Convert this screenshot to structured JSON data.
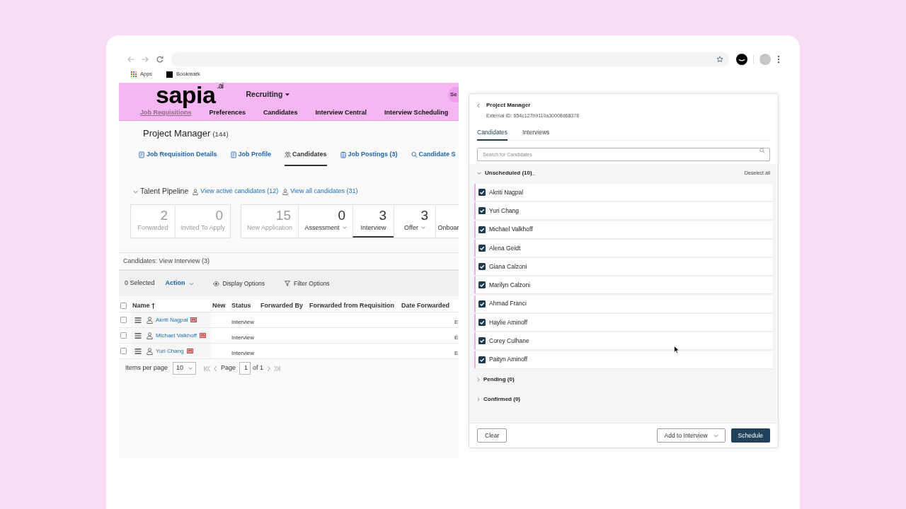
{
  "browser": {
    "bookmarks": [
      {
        "kind": "apps",
        "label": "Apps"
      },
      {
        "kind": "site",
        "label": "Bookmark"
      }
    ]
  },
  "header": {
    "logo": "sapia$^{.ai}$",
    "product_menu": "Recruiting",
    "search": "Se",
    "nav": [
      {
        "label": "Job Requisitions",
        "selected": true
      },
      {
        "label": "Preferences",
        "selected": false
      },
      {
        "label": "Candidates",
        "selected": false
      },
      {
        "label": "Interview Central",
        "selected": false
      },
      {
        "label": "Interview Scheduling",
        "selected": false
      }
    ]
  },
  "requisition": {
    "title": "Project Manager",
    "count": "(144)",
    "tabs": [
      {
        "label": "Job Requisition Details",
        "selected": false
      },
      {
        "label": "Job Profile",
        "selected": false
      },
      {
        "label": "Candidates",
        "selected": true
      },
      {
        "label": "Job Postings (3)",
        "selected": false
      },
      {
        "label": "Candidate S",
        "selected": false
      }
    ]
  },
  "pipeline": {
    "title": "Talent Pipeline",
    "expanded": true,
    "links": [
      "View active candidates (12)",
      "View all candidates (31)"
    ],
    "groups": [
      [
        {
          "count": "2",
          "label": "Forwarded",
          "muted": true,
          "has_menu": false,
          "selected": false
        },
        {
          "count": "0",
          "label": "Invited To Apply",
          "muted": true,
          "has_menu": false,
          "selected": false
        }
      ],
      [
        {
          "count": "15",
          "label": "New Application",
          "muted": true,
          "has_menu": false,
          "selected": false
        },
        {
          "count": "0",
          "label": "Assessment",
          "muted": false,
          "has_menu": true,
          "selected": false
        },
        {
          "count": "3",
          "label": "Interview",
          "muted": false,
          "has_menu": false,
          "selected": true
        },
        {
          "count": "3",
          "label": "Offer",
          "muted": false,
          "has_menu": true,
          "selected": false
        },
        {
          "label": "Onboar",
          "muted": false,
          "has_menu": false,
          "selected": false
        }
      ]
    ]
  },
  "candidates": {
    "title": "Candidates: View Interview (3)",
    "selected_count": "0 Selected",
    "action": "Action",
    "display_options": "Display Options",
    "filter_options": "Filter Options",
    "all_checked": false,
    "columns": [
      {
        "label": "Name",
        "sorted": true
      },
      {
        "label": "New",
        "sorted": false
      },
      {
        "label": "Status",
        "sorted": false
      },
      {
        "label": "Forwarded By",
        "sorted": false
      },
      {
        "label": "Forwarded from Requisition",
        "sorted": false
      },
      {
        "label": "Date Forwarded",
        "sorted": false
      }
    ],
    "rows": [
      {
        "checked": false,
        "name": "Akriti Nagpal",
        "status": "Interview",
        "column_7": "E"
      },
      {
        "checked": false,
        "name": "Michael Valkhoff",
        "status": "Interview",
        "column_7": "E"
      },
      {
        "checked": false,
        "name": "Yuri Chang",
        "status": "Interview",
        "column_7": "E"
      }
    ],
    "pagination": {
      "items_per_page": "Items per page",
      "per_page": "10",
      "page_label": "Page",
      "page": "1",
      "page_count": "of 1"
    }
  },
  "panel": {
    "title": "Project Manager",
    "external_id": "External ID: 654c127b9110a30008d68378",
    "tabs": [
      {
        "label": "Candidates",
        "selected": true
      },
      {
        "label": "Interviews",
        "selected": false
      }
    ],
    "search": {
      "placeholder": "Search for Candidates"
    },
    "groups": [
      {
        "title": "Unscheduled (10)_",
        "expanded": true,
        "action": "Deselect all",
        "candidates": [
          {
            "name": "Akriti Nagpal",
            "checked": true
          },
          {
            "name": "Yuri Chang",
            "checked": true
          },
          {
            "name": "Michael Valkhoff",
            "checked": true
          },
          {
            "name": "Alena Geidt",
            "checked": true
          },
          {
            "name": "Giana Calzoni",
            "checked": true
          },
          {
            "name": "Marilyn Calzoni",
            "checked": true
          },
          {
            "name": "Ahmad Franci",
            "checked": true
          },
          {
            "name": "Haylie Aminoff",
            "checked": true
          },
          {
            "name": "Corey Culhane",
            "checked": true
          },
          {
            "name": "Paityn Aminoff",
            "checked": true
          }
        ]
      },
      {
        "title": "Pending (0)",
        "expanded": false
      },
      {
        "title": "Confirmed (0)",
        "expanded": false
      }
    ],
    "buttons": [
      {
        "kind": "outline",
        "label": "Clear"
      },
      {
        "kind": "dropdown",
        "label": "Add to Interview"
      },
      {
        "kind": "primary",
        "label": "Schedule"
      }
    ]
  }
}
